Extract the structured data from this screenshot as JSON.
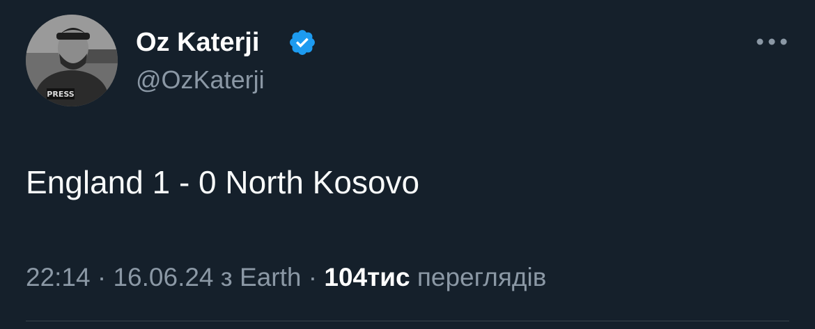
{
  "author": {
    "display_name": "Oz Katerji",
    "handle": "@OzKaterji",
    "verified": true,
    "avatar_badge_text": "PRESS"
  },
  "tweet": {
    "text": "England 1 - 0 North Kosovo"
  },
  "meta": {
    "time": "22:14",
    "separator1": "·",
    "date": "16.06.24",
    "source_prefix": "з",
    "source": "Earth",
    "separator2": "·",
    "views_count": "104тис",
    "views_label": "переглядів"
  },
  "icons": {
    "verified": "verified-badge-icon",
    "more": "more-options-icon"
  },
  "colors": {
    "background": "#15202b",
    "primary_text": "#ffffff",
    "secondary_text": "#8b98a5",
    "verified_blue": "#1d9bf0",
    "divider": "#38444d"
  }
}
